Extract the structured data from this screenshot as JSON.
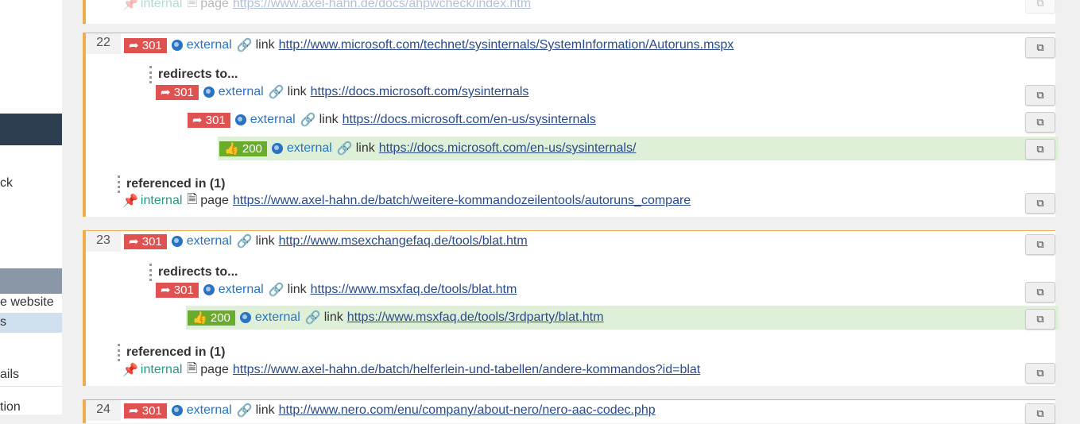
{
  "sidebar": {
    "items": [
      "ck",
      "e website",
      "s",
      "ails",
      "tion"
    ]
  },
  "rows": {
    "r21_tail": {
      "pin": "📌",
      "scope": "internal",
      "kind": "page",
      "url": "https://www.axel-hahn.de/docs/ahpwcheck/index.htm"
    },
    "r22": {
      "num": "22",
      "status": "301",
      "scope": "external",
      "kind": "link",
      "url": "http://www.microsoft.com/technet/sysinternals/SystemInformation/Autoruns.mspx",
      "redirects_label": "redirects to...",
      "hops": [
        {
          "status": "301",
          "scope": "external",
          "kind": "link",
          "url": "https://docs.microsoft.com/sysinternals"
        },
        {
          "status": "301",
          "scope": "external",
          "kind": "link",
          "url": "https://docs.microsoft.com/en-us/sysinternals"
        },
        {
          "status": "200",
          "scope": "external",
          "kind": "link",
          "url": "https://docs.microsoft.com/en-us/sysinternals/"
        }
      ],
      "referenced_label": "referenced in (1)",
      "ref": {
        "scope": "internal",
        "kind": "page",
        "url": "https://www.axel-hahn.de/batch/weitere-kommandozeilentools/autoruns_compare"
      }
    },
    "r23": {
      "num": "23",
      "status": "301",
      "scope": "external",
      "kind": "link",
      "url": "http://www.msexchangefaq.de/tools/blat.htm",
      "redirects_label": "redirects to...",
      "hops": [
        {
          "status": "301",
          "scope": "external",
          "kind": "link",
          "url": "https://www.msxfaq.de/tools/blat.htm"
        },
        {
          "status": "200",
          "scope": "external",
          "kind": "link",
          "url": "https://www.msxfaq.de/tools/3rdparty/blat.htm"
        }
      ],
      "referenced_label": "referenced in (1)",
      "ref": {
        "scope": "internal",
        "kind": "page",
        "url": "https://www.axel-hahn.de/batch/helferlein-und-tabellen/andere-kommandos?id=blat"
      }
    },
    "r24": {
      "num": "24",
      "status": "301",
      "scope": "external",
      "kind": "link",
      "url": "http://www.nero.com/enu/company/about-nero/nero-aac-codec.php"
    }
  }
}
